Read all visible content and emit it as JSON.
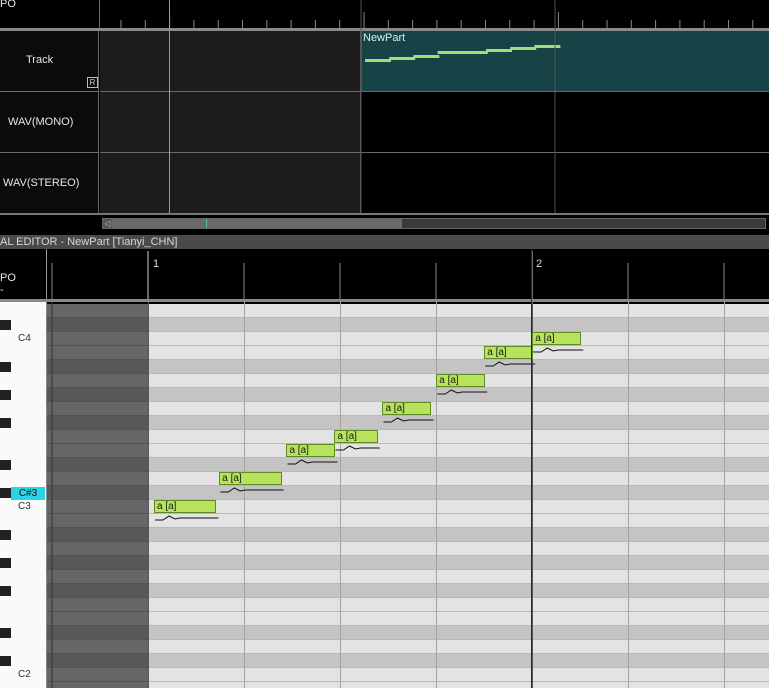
{
  "arrangement": {
    "ruler_label": "PO",
    "tracks": [
      {
        "name": "Track",
        "badge": "R"
      },
      {
        "name": "WAV(MONO)"
      },
      {
        "name": "WAV(STEREO)"
      }
    ],
    "part": {
      "name": "NewPart",
      "pitches": [
        55,
        56,
        57,
        59,
        59,
        60,
        61,
        62
      ],
      "color": "#174347",
      "note_color": "#9ee07a"
    },
    "scroll_left_label": "◁"
  },
  "editor": {
    "title": "AL EDITOR - NewPart [Tianyi_CHN]",
    "ruler_label": "PO",
    "ruler_sub": "-",
    "measures": [
      "1",
      "2"
    ],
    "keyboard_top_pitch": 62,
    "keyboard_labels": [
      {
        "pitch": 60,
        "text": "C4"
      },
      {
        "pitch": 49,
        "text": "C#3",
        "highlight": true
      },
      {
        "pitch": 48,
        "text": "C3"
      },
      {
        "pitch": 36,
        "text": "C2"
      }
    ],
    "notes": [
      {
        "pitch": 48,
        "start": 0,
        "length": 0.32,
        "lyric": "a [a]"
      },
      {
        "pitch": 50,
        "start": 0.34,
        "length": 0.32,
        "lyric": "a [a]"
      },
      {
        "pitch": 52,
        "start": 0.69,
        "length": 0.25,
        "lyric": "a [a]"
      },
      {
        "pitch": 53,
        "start": 0.94,
        "length": 0.22,
        "lyric": "a [a]"
      },
      {
        "pitch": 55,
        "start": 1.19,
        "length": 0.25,
        "lyric": "a [a]"
      },
      {
        "pitch": 57,
        "start": 1.47,
        "length": 0.25,
        "lyric": "a [a]"
      },
      {
        "pitch": 59,
        "start": 1.72,
        "length": 0.25,
        "lyric": "a [a]"
      },
      {
        "pitch": 60,
        "start": 1.97,
        "length": 0.25,
        "lyric": "a [a]"
      }
    ],
    "colors": {
      "note": "#b6e35b",
      "highlight_key": "#2bd3e6",
      "white_row": "#e3e3e3",
      "black_row": "#c4c4c4"
    }
  }
}
